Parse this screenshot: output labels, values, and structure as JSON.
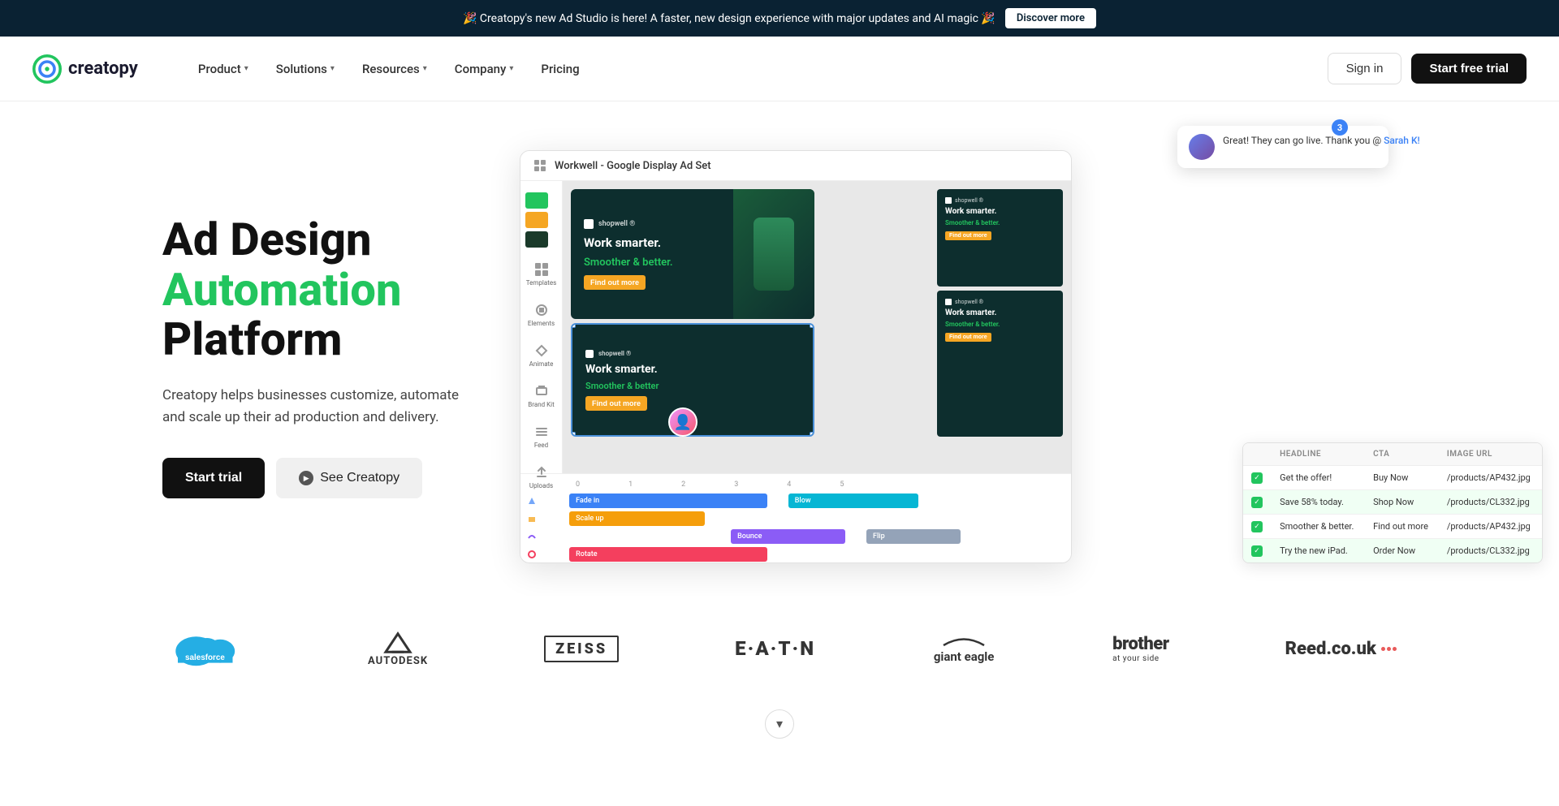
{
  "banner": {
    "text": "🎉 Creatopy's new Ad Studio is here! A faster, new design experience with major updates and AI magic 🎉",
    "cta": "Discover more"
  },
  "nav": {
    "logo_text": "creatopy",
    "items": [
      {
        "label": "Product",
        "has_dropdown": true
      },
      {
        "label": "Solutions",
        "has_dropdown": true
      },
      {
        "label": "Resources",
        "has_dropdown": true
      },
      {
        "label": "Company",
        "has_dropdown": true
      },
      {
        "label": "Pricing",
        "has_dropdown": false
      }
    ],
    "signin": "Sign in",
    "start_trial": "Start free trial"
  },
  "hero": {
    "title_line1": "Ad Design",
    "title_line2": "Automation",
    "title_line3": "Platform",
    "description": "Creatopy helps businesses customize, automate and scale up their ad production and delivery.",
    "btn_trial": "Start trial",
    "btn_see": "See Creatopy"
  },
  "editor": {
    "header_title": "Workwell - Google Display Ad Set",
    "sidebar_items": [
      {
        "icon": "templates",
        "label": "Templates"
      },
      {
        "icon": "elements",
        "label": "Elements"
      },
      {
        "icon": "animate",
        "label": "Animate"
      },
      {
        "icon": "brand",
        "label": "Brand Kit"
      },
      {
        "icon": "feed",
        "label": "Feed"
      },
      {
        "icon": "uploads",
        "label": "Uploads"
      }
    ],
    "ad_headline": "Work smarter.",
    "ad_subline": "Smoother & better.",
    "ad_cta": "Find out more",
    "timeline": {
      "ruler": [
        "0",
        "1",
        "2",
        "3",
        "4",
        "5"
      ],
      "tracks": [
        {
          "label": "Fade in",
          "color": "#3b82f6",
          "left": "5%",
          "width": "35%"
        },
        {
          "label": "Blow",
          "color": "#06b6d4",
          "left": "42%",
          "width": "28%"
        },
        {
          "label": "Scale up",
          "color": "#f59e0b",
          "left": "5%",
          "width": "28%"
        },
        {
          "label": "Bounce",
          "color": "#8b5cf6",
          "left": "38%",
          "width": "24%"
        },
        {
          "label": "Flip",
          "color": "#94a3b8",
          "left": "65%",
          "width": "18%"
        },
        {
          "label": "Rotate",
          "color": "#f43f5e",
          "left": "5%",
          "width": "35%"
        }
      ]
    }
  },
  "data_table": {
    "columns": [
      "HEADLINE",
      "CTA",
      "IMAGE URL"
    ],
    "rows": [
      {
        "checked": true,
        "headline": "Get the offer!",
        "cta": "Buy Now",
        "image": "/products/AP432.jpg"
      },
      {
        "checked": true,
        "headline": "Save 58% today.",
        "cta": "Shop Now",
        "image": "/products/CL332.jpg"
      },
      {
        "checked": true,
        "headline": "Smoother & better.",
        "cta": "Find out more",
        "image": "/products/AP432.jpg"
      },
      {
        "checked": true,
        "headline": "Try the new iPad.",
        "cta": "Order Now",
        "image": "/products/CL332.jpg"
      }
    ]
  },
  "notification": {
    "message": "Great! They can go live. Thank you @",
    "mention": "Sarah K!",
    "badge": "3"
  },
  "logos": [
    {
      "name": "Salesforce",
      "type": "salesforce"
    },
    {
      "name": "Autodesk",
      "type": "text"
    },
    {
      "name": "Zeiss",
      "type": "text"
    },
    {
      "name": "Eaton",
      "type": "text"
    },
    {
      "name": "Giant Eagle",
      "type": "text"
    },
    {
      "name": "brother at your side",
      "type": "text"
    },
    {
      "name": "Reed.co.uk",
      "type": "text"
    }
  ],
  "scroll_btn": "▾"
}
